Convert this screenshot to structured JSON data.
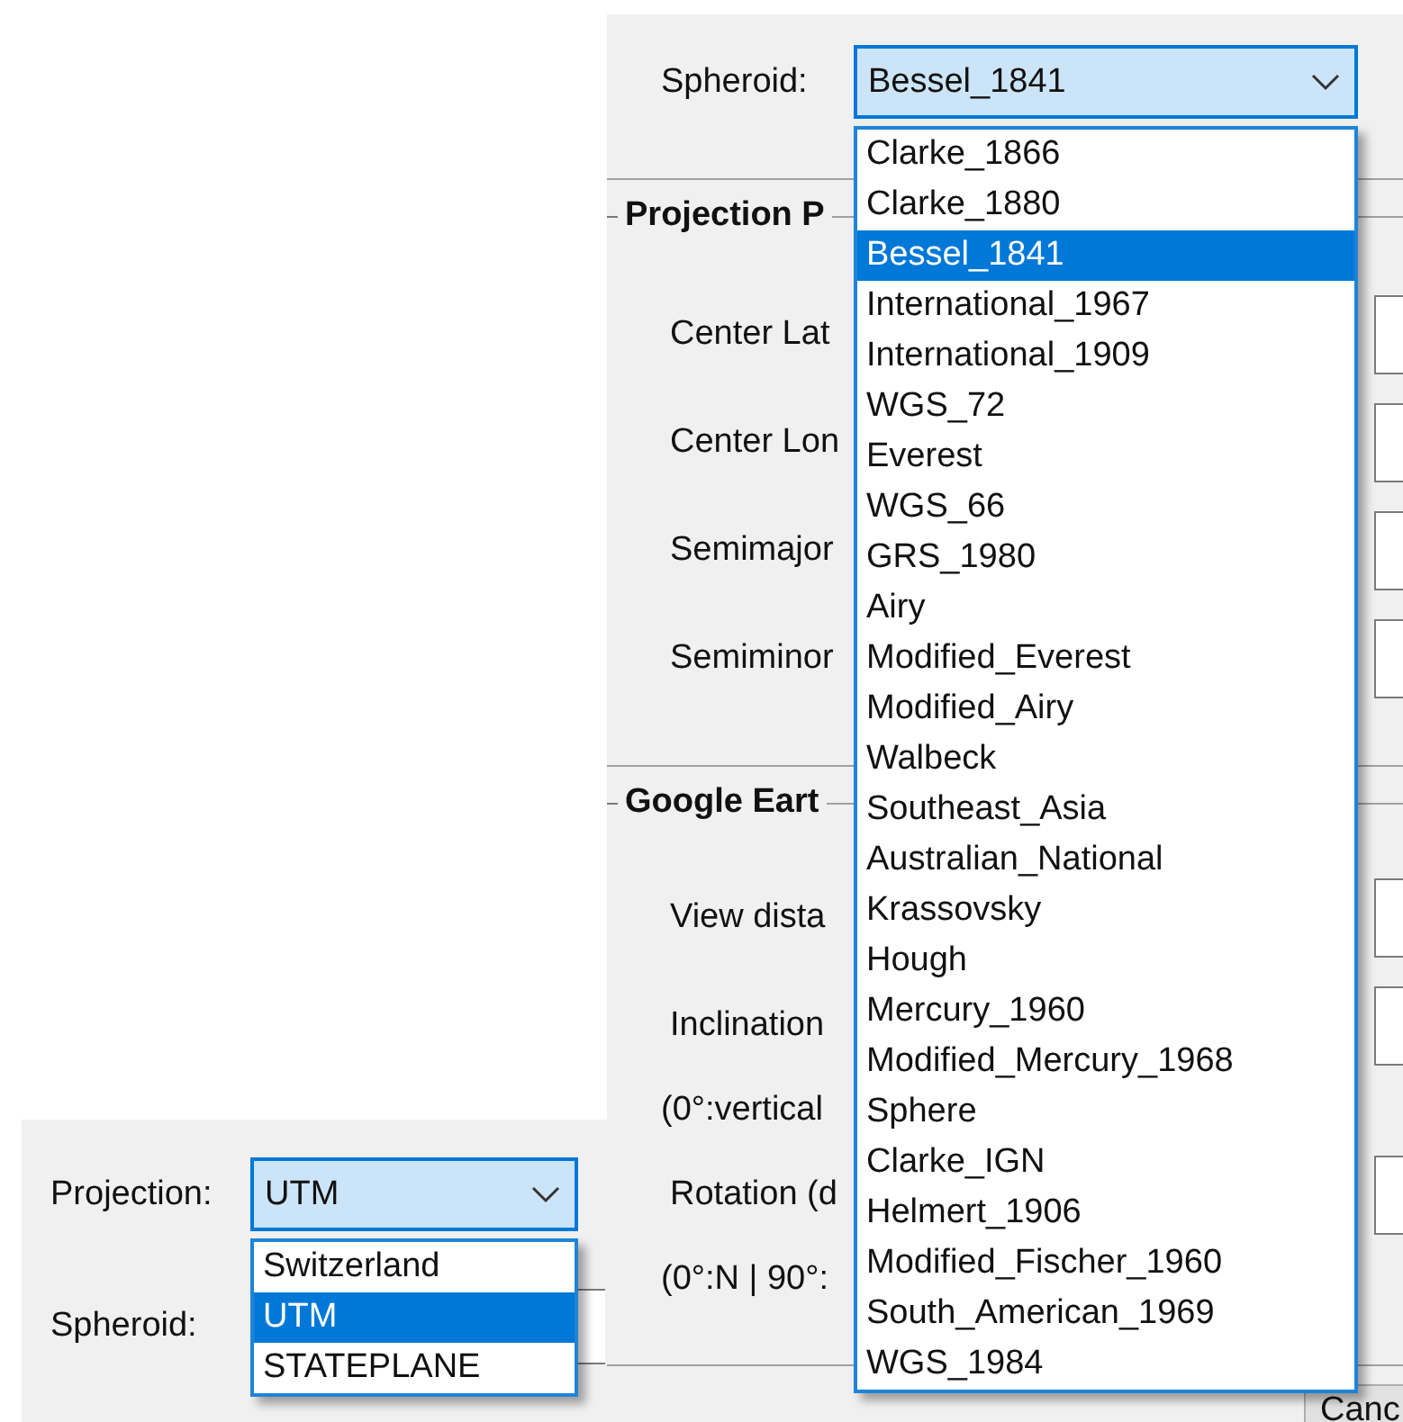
{
  "right_dialog": {
    "spheroid": {
      "label": "Spheroid:",
      "value": "Bessel_1841",
      "expanded": true,
      "options": [
        {
          "label": "Clarke_1866",
          "selected": false
        },
        {
          "label": "Clarke_1880",
          "selected": false
        },
        {
          "label": "Bessel_1841",
          "selected": true
        },
        {
          "label": "International_1967",
          "selected": false
        },
        {
          "label": "International_1909",
          "selected": false
        },
        {
          "label": "WGS_72",
          "selected": false
        },
        {
          "label": "Everest",
          "selected": false
        },
        {
          "label": "WGS_66",
          "selected": false
        },
        {
          "label": "GRS_1980",
          "selected": false
        },
        {
          "label": "Airy",
          "selected": false
        },
        {
          "label": "Modified_Everest",
          "selected": false
        },
        {
          "label": "Modified_Airy",
          "selected": false
        },
        {
          "label": "Walbeck",
          "selected": false
        },
        {
          "label": "Southeast_Asia",
          "selected": false
        },
        {
          "label": "Australian_National",
          "selected": false
        },
        {
          "label": "Krassovsky",
          "selected": false
        },
        {
          "label": "Hough",
          "selected": false
        },
        {
          "label": "Mercury_1960",
          "selected": false
        },
        {
          "label": "Modified_Mercury_1968",
          "selected": false
        },
        {
          "label": "Sphere",
          "selected": false
        },
        {
          "label": "Clarke_IGN",
          "selected": false
        },
        {
          "label": "Helmert_1906",
          "selected": false
        },
        {
          "label": "Modified_Fischer_1960",
          "selected": false
        },
        {
          "label": "South_American_1969",
          "selected": false
        },
        {
          "label": "WGS_1984",
          "selected": false
        }
      ]
    },
    "groups": [
      {
        "title": "Projection P",
        "rows": [
          {
            "kind": "field",
            "label": "Center Lat"
          },
          {
            "kind": "field",
            "label": "Center Lon"
          },
          {
            "kind": "field",
            "label": "Semimajor"
          },
          {
            "kind": "field",
            "label": "Semiminor"
          }
        ]
      },
      {
        "title": "Google Eart",
        "rows": [
          {
            "kind": "field",
            "label": "View dista"
          },
          {
            "kind": "field",
            "label": "Inclination"
          },
          {
            "kind": "note",
            "label": "(0°:vertical"
          },
          {
            "kind": "field",
            "label": "Rotation (d"
          },
          {
            "kind": "note",
            "label": "(0°:N | 90°:"
          }
        ]
      }
    ],
    "buttons": [
      "Canc"
    ]
  },
  "left_dialog": {
    "projection": {
      "label": "Projection:",
      "value": "UTM",
      "expanded": true,
      "options": [
        {
          "label": "Switzerland",
          "selected": false
        },
        {
          "label": "UTM",
          "selected": true
        },
        {
          "label": "STATEPLANE",
          "selected": false
        }
      ]
    },
    "spheroid": {
      "label": "Spheroid:"
    }
  }
}
